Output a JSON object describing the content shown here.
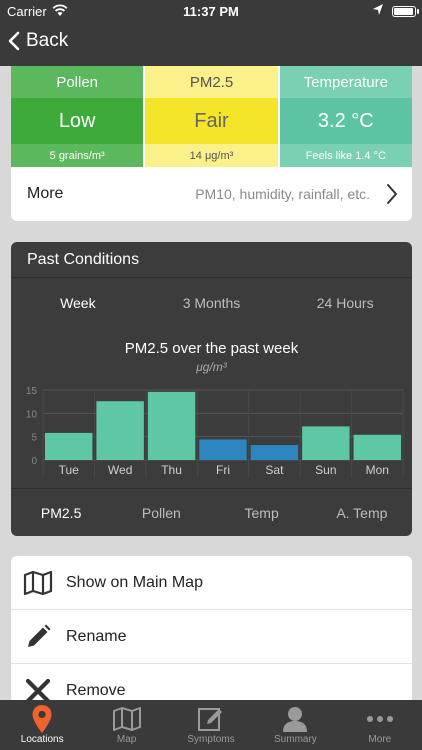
{
  "status_bar": {
    "carrier": "Carrier",
    "time": "11:37 PM"
  },
  "nav": {
    "back_label": "Back"
  },
  "conditions": {
    "tiles": [
      {
        "title": "Pollen",
        "value": "Low",
        "detail": "5 grains/m³"
      },
      {
        "title": "PM2.5",
        "value": "Fair",
        "detail": "14 μg/m³"
      },
      {
        "title": "Temperature",
        "value": "3.2 °C",
        "detail": "Feels like 1.4 °C"
      }
    ],
    "more": {
      "label": "More",
      "detail": "PM10, humidity, rainfall, etc."
    }
  },
  "past_conditions": {
    "title": "Past Conditions",
    "range_tabs": [
      "Week",
      "3 Months",
      "24 Hours"
    ],
    "active_range": "Week",
    "metric_tabs": [
      "PM2.5",
      "Pollen",
      "Temp",
      "A. Temp"
    ],
    "active_metric": "PM2.5"
  },
  "chart_data": {
    "type": "bar",
    "title": "PM2.5 over the past week",
    "ylabel": "μg/m³",
    "categories": [
      "Tue",
      "Wed",
      "Thu",
      "Fri",
      "Sat",
      "Sun",
      "Mon"
    ],
    "values": [
      5.8,
      12.6,
      14.6,
      4.4,
      3.2,
      7.2,
      5.4
    ],
    "yticks": [
      0,
      5,
      10,
      15
    ],
    "ylim": [
      0,
      15
    ],
    "grid": true,
    "bar_colors": [
      "#5ec8a6",
      "#5ec8a6",
      "#5ec8a6",
      "#2e86c1",
      "#2e86c1",
      "#5ec8a6",
      "#5ec8a6"
    ]
  },
  "actions": [
    {
      "label": "Show on Main Map",
      "icon": "map-icon"
    },
    {
      "label": "Rename",
      "icon": "pencil-icon"
    },
    {
      "label": "Remove",
      "icon": "x-icon"
    }
  ],
  "tabbar": {
    "items": [
      {
        "label": "Locations",
        "icon": "location-pin-icon",
        "active": true
      },
      {
        "label": "Map",
        "icon": "map-icon",
        "active": false
      },
      {
        "label": "Symptoms",
        "icon": "edit-icon",
        "active": false
      },
      {
        "label": "Summary",
        "icon": "person-icon",
        "active": false
      },
      {
        "label": "More",
        "icon": "more-dots-icon",
        "active": false
      }
    ],
    "active_color": "#f0622e"
  }
}
